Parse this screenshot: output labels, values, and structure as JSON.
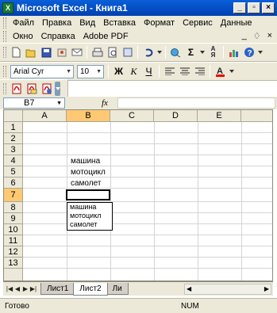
{
  "window": {
    "title": "Microsoft Excel - Книга1",
    "icon": "excel-icon"
  },
  "menu": {
    "items": [
      "Файл",
      "Правка",
      "Вид",
      "Вставка",
      "Формат",
      "Сервис",
      "Данные"
    ],
    "items2": [
      "Окно",
      "Справка",
      "Adobe PDF"
    ],
    "doc_controls": [
      "_",
      "♢",
      "×"
    ]
  },
  "format_toolbar": {
    "font_name": "Arial Cyr",
    "font_size": "10"
  },
  "formula_bar": {
    "name_box": "B7",
    "fx": "fx",
    "formula": ""
  },
  "grid": {
    "columns": [
      "A",
      "B",
      "C",
      "D",
      "E"
    ],
    "rows": [
      "1",
      "2",
      "3",
      "4",
      "5",
      "6",
      "7",
      "8",
      "9",
      "10",
      "11",
      "12",
      "13"
    ],
    "selected_column": "B",
    "selected_row": "7",
    "cells": {
      "B4": "машина",
      "B5": "мотоцикл",
      "B6": "самолет"
    }
  },
  "autocomplete": {
    "options": [
      "машина",
      "мотоцикл",
      "самолет"
    ]
  },
  "sheet_tabs": {
    "tabs": [
      "Лист1",
      "Лист2",
      "Ли"
    ],
    "active": "Лист2"
  },
  "status": {
    "ready": "Готово",
    "num": "NUM"
  },
  "colors": {
    "title_bar": "#0a5fd8",
    "chrome": "#ece9d8",
    "header_highlight": "#ffc873"
  }
}
